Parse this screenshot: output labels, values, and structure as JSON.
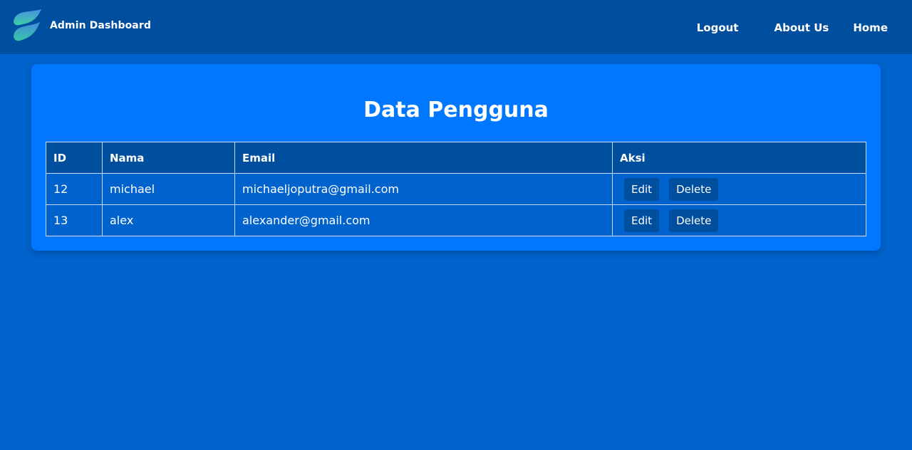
{
  "navbar": {
    "brand_title": "Admin Dashboard",
    "links": {
      "logout": "Logout",
      "about": "About Us",
      "home": "Home"
    }
  },
  "card": {
    "title": "Data Pengguna"
  },
  "table": {
    "headers": {
      "id": "ID",
      "nama": "Nama",
      "email": "Email",
      "aksi": "Aksi"
    },
    "rows": [
      {
        "id": "12",
        "nama": "michael",
        "email": "michaeljoputra@gmail.com",
        "edit": "Edit",
        "delete": "Delete"
      },
      {
        "id": "13",
        "nama": "alex",
        "email": "alexander@gmail.com",
        "edit": "Edit",
        "delete": "Delete"
      }
    ]
  },
  "colors": {
    "page_background": "#0062cc",
    "navbar_background": "#004f9f",
    "card_background": "#0077ff",
    "button_background": "#004f9f",
    "logo_top": "#4a90e2",
    "logo_bottom": "#3ccfa6"
  },
  "icons": {
    "logo": "leaf-wave-logo-icon"
  }
}
